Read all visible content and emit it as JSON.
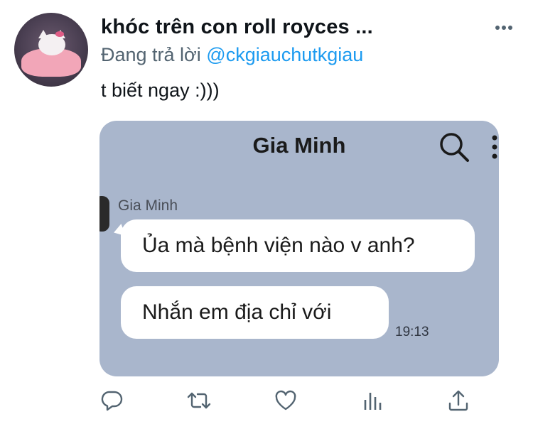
{
  "tweet": {
    "display_name": "khóc trên con roll royces ...",
    "reply_prefix": "Đang trả lời",
    "reply_to": "@ckgiauchutkgiau",
    "text": "t biết ngay :)))"
  },
  "chat": {
    "title": "Gia Minh",
    "sender": "Gia Minh",
    "messages": [
      {
        "text": "Ủa mà bệnh viện nào v anh?"
      },
      {
        "text": "Nhắn em địa chỉ với"
      }
    ],
    "time": "19:13",
    "background": "#a9b6cc"
  },
  "icons": {
    "more": "more-dots-icon",
    "reply": "reply-bubble-icon",
    "retweet": "retweet-icon",
    "like": "heart-icon",
    "analytics": "bar-chart-icon",
    "share": "share-icon"
  },
  "colors": {
    "mention": "#1d9bf0",
    "secondary": "#536471",
    "action_icon": "#536471"
  }
}
